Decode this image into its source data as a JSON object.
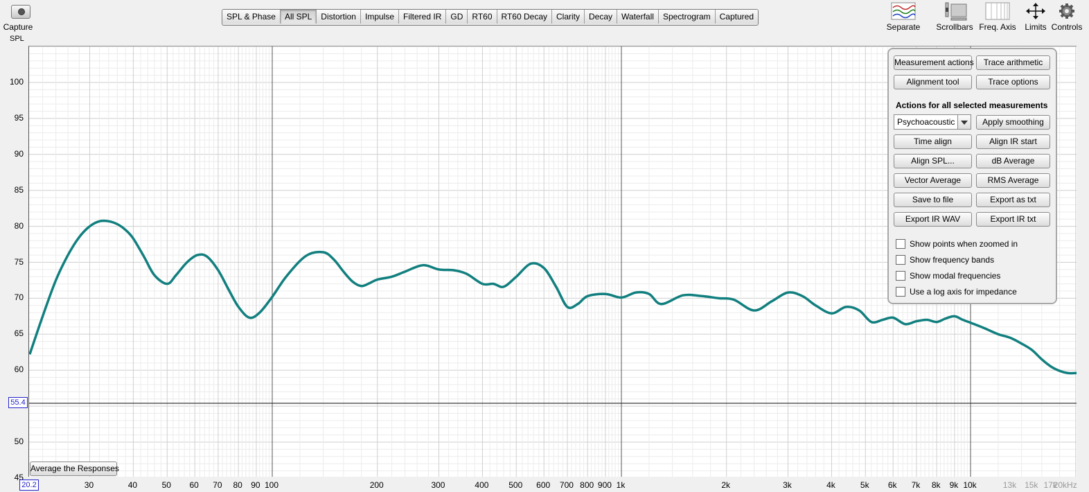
{
  "capture": {
    "label": "Capture"
  },
  "axis_title": "SPL",
  "tabs": [
    {
      "label": "SPL & Phase",
      "active": false
    },
    {
      "label": "All SPL",
      "active": true
    },
    {
      "label": "Distortion",
      "active": false
    },
    {
      "label": "Impulse",
      "active": false
    },
    {
      "label": "Filtered IR",
      "active": false
    },
    {
      "label": "GD",
      "active": false
    },
    {
      "label": "RT60",
      "active": false
    },
    {
      "label": "RT60 Decay",
      "active": false
    },
    {
      "label": "Clarity",
      "active": false
    },
    {
      "label": "Decay",
      "active": false
    },
    {
      "label": "Waterfall",
      "active": false
    },
    {
      "label": "Spectrogram",
      "active": false
    },
    {
      "label": "Captured",
      "active": false
    }
  ],
  "toolbar": {
    "separate": "Separate",
    "scrollbars": "Scrollbars",
    "freq_axis": "Freq. Axis",
    "limits": "Limits",
    "controls": "Controls"
  },
  "cursor": {
    "y_value": "55.4",
    "x_value": "20.2"
  },
  "average_button": "Average the Responses",
  "panel": {
    "measurement_actions": "Measurement actions",
    "trace_arithmetic": "Trace arithmetic",
    "alignment_tool": "Alignment tool",
    "trace_options": "Trace options",
    "heading": "Actions for all selected measurements",
    "smoothing_value": "Psychoacoustic",
    "apply_smoothing": "Apply smoothing",
    "time_align": "Time align",
    "align_ir_start": "Align IR start",
    "align_spl": "Align SPL...",
    "db_average": "dB Average",
    "vector_average": "Vector Average",
    "rms_average": "RMS Average",
    "save_to_file": "Save to file",
    "export_as_txt": "Export as txt",
    "export_ir_wav": "Export IR WAV",
    "export_ir_txt": "Export IR txt",
    "checkboxes": [
      {
        "label": "Show points when zoomed in",
        "checked": false
      },
      {
        "label": "Show frequency bands",
        "checked": false
      },
      {
        "label": "Show modal frequencies",
        "checked": false
      },
      {
        "label": "Use a log axis for impedance",
        "checked": false
      }
    ]
  },
  "colors": {
    "trace": "#127f7f",
    "cursor": "#2222cc"
  },
  "chart_data": {
    "type": "line",
    "title": "",
    "xlabel": "",
    "ylabel": "SPL",
    "x_scale": "log",
    "xlim": [
      20.2,
      21000
    ],
    "ylim": [
      45,
      105
    ],
    "yticks": [
      45,
      50,
      55,
      60,
      65,
      70,
      75,
      80,
      85,
      90,
      95,
      100
    ],
    "ytick_labels": [
      "45",
      "50",
      "55",
      "60",
      "65",
      "70",
      "75",
      "80",
      "85",
      "90",
      "95",
      "100"
    ],
    "xticks": [
      30,
      40,
      50,
      60,
      70,
      80,
      90,
      100,
      200,
      300,
      400,
      500,
      600,
      700,
      800,
      900,
      1000,
      2000,
      3000,
      4000,
      5000,
      6000,
      7000,
      8000,
      9000,
      10000,
      13000,
      15000,
      17000,
      20000
    ],
    "xtick_labels": [
      "30",
      "40",
      "50",
      "60",
      "70",
      "80",
      "90",
      "100",
      "200",
      "300",
      "400",
      "500",
      "600",
      "700",
      "800",
      "900",
      "1k",
      "2k",
      "3k",
      "4k",
      "5k",
      "6k",
      "7k",
      "8k",
      "9k",
      "10k",
      "13k",
      "15k",
      "17k",
      "20kHz"
    ],
    "xtick_grey": [
      "13k",
      "15k",
      "17k",
      "20kHz"
    ],
    "cursor_line_y": 55.4,
    "grid": true,
    "series": [
      {
        "x": [
          20.2,
          22,
          24,
          26,
          28,
          30,
          32,
          34,
          36,
          38,
          40,
          43,
          46,
          50,
          53,
          57,
          61,
          65,
          70,
          75,
          80,
          86,
          92,
          100,
          110,
          125,
          140,
          150,
          160,
          170,
          180,
          190,
          200,
          220,
          240,
          270,
          300,
          330,
          360,
          400,
          430,
          460,
          500,
          550,
          600,
          650,
          700,
          750,
          800,
          900,
          1000,
          1100,
          1200,
          1300,
          1500,
          1700,
          1900,
          2100,
          2400,
          2700,
          3000,
          3300,
          3600,
          4000,
          4400,
          4800,
          5200,
          5600,
          6000,
          6500,
          7000,
          7500,
          8000,
          8500,
          9000,
          9500,
          10000,
          11000,
          12000,
          13000,
          14000,
          15000,
          16000,
          17000,
          18000,
          19000,
          20000,
          21000
        ],
        "y": [
          62.2,
          67.5,
          72.5,
          76.0,
          78.5,
          80.0,
          80.7,
          80.7,
          80.3,
          79.5,
          78.3,
          75.7,
          73.2,
          72.0,
          73.2,
          75.0,
          76.0,
          75.8,
          73.9,
          71.2,
          68.8,
          67.3,
          68.0,
          70.2,
          73.1,
          75.9,
          76.4,
          75.4,
          73.7,
          72.3,
          71.7,
          72.1,
          72.6,
          73.0,
          73.7,
          74.6,
          74.0,
          73.9,
          73.4,
          72.0,
          72.0,
          71.6,
          73.0,
          74.8,
          74.2,
          71.6,
          68.8,
          69.2,
          70.3,
          70.6,
          70.1,
          70.8,
          70.6,
          69.2,
          70.4,
          70.3,
          70.0,
          69.8,
          68.3,
          69.6,
          70.8,
          70.3,
          69.0,
          67.9,
          68.8,
          68.3,
          66.7,
          67.0,
          67.3,
          66.4,
          66.8,
          67.0,
          66.7,
          67.2,
          67.5,
          67.0,
          66.6,
          65.8,
          65.0,
          64.5,
          63.7,
          62.8,
          61.5,
          60.5,
          59.9,
          59.6,
          59.6,
          59.6
        ]
      }
    ]
  }
}
